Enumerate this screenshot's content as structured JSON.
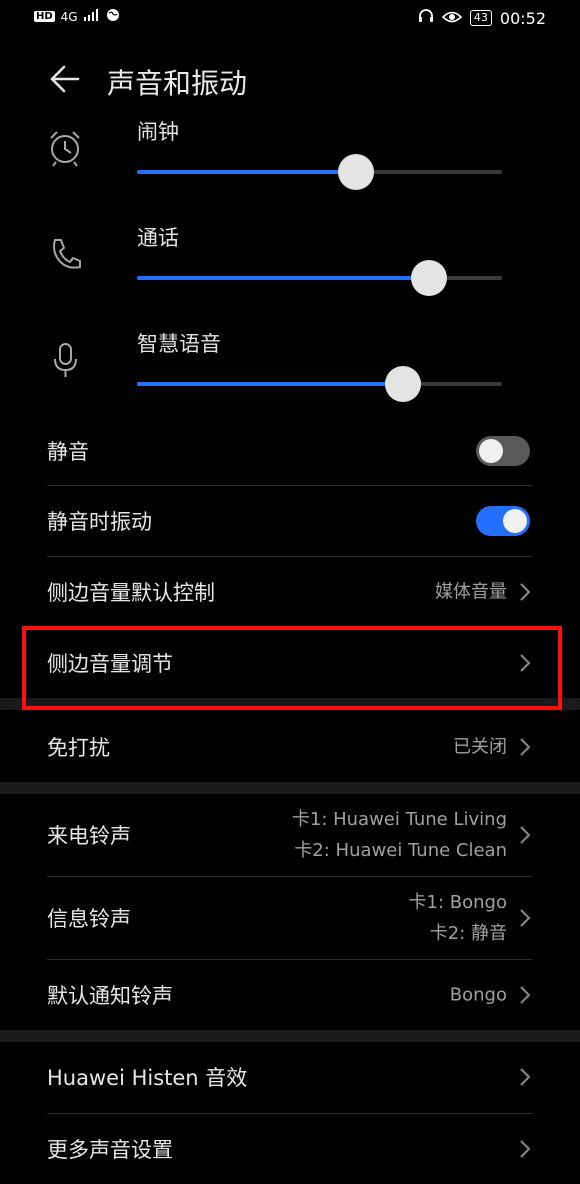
{
  "status_bar": {
    "left_badge": "HD",
    "network": "4G",
    "battery": "43",
    "time": "00:52"
  },
  "header": {
    "title": "声音和振动"
  },
  "volumes": [
    {
      "label": "闹钟",
      "icon": "alarm-clock-icon",
      "level": 0.6
    },
    {
      "label": "通话",
      "icon": "phone-icon",
      "level": 0.8
    },
    {
      "label": "智慧语音",
      "icon": "microphone-icon",
      "level": 0.73
    }
  ],
  "settings": {
    "mute": {
      "label": "静音",
      "on": false
    },
    "vibrate_on_mute": {
      "label": "静音时振动",
      "on": true
    },
    "side_volume_default": {
      "label": "侧边音量默认控制",
      "value": "媒体音量"
    },
    "side_volume_adjust": {
      "label": "侧边音量调节"
    },
    "dnd": {
      "label": "免打扰",
      "value": "已关闭"
    },
    "ringtone": {
      "label": "来电铃声",
      "value_line1": "卡1: Huawei Tune Living",
      "value_line2": "卡2: Huawei Tune Clean"
    },
    "message_tone": {
      "label": "信息铃声",
      "value_line1": "卡1: Bongo",
      "value_line2": "卡2: 静音"
    },
    "notification_tone": {
      "label": "默认通知铃声",
      "value": "Bongo"
    },
    "histen": {
      "label": "Huawei Histen 音效"
    },
    "more_sound": {
      "label": "更多声音设置"
    }
  },
  "colors": {
    "accent": "#256fff",
    "highlight": "#ff1010"
  }
}
